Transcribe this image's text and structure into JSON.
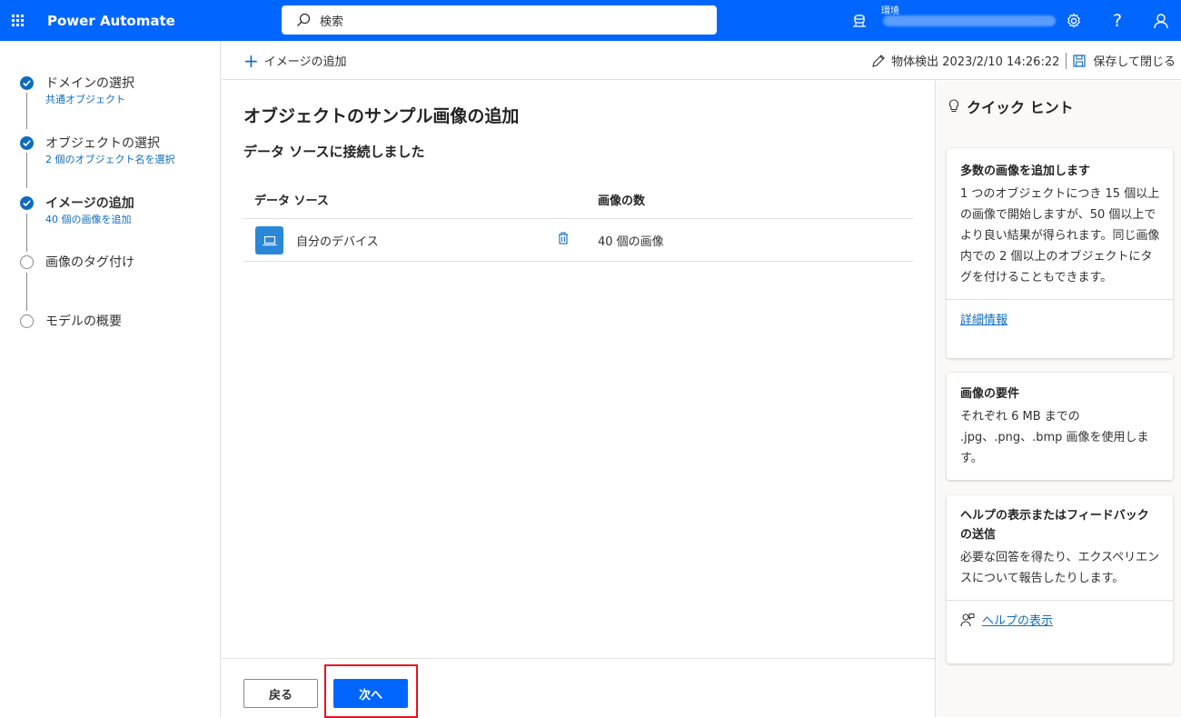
{
  "colors": {
    "topbar": "#0066ff",
    "accent": "#0f6cbd",
    "highlight": "#e81123",
    "device_icon": "#2b88d8"
  },
  "topbar": {
    "app_name": "Power Automate",
    "search_placeholder": "検索",
    "env_label": "環境"
  },
  "stepper": {
    "steps": [
      {
        "title": "ドメインの選択",
        "sub": "共通オブジェクト",
        "state": "done"
      },
      {
        "title": "オブジェクトの選択",
        "sub": "2 個のオブジェクト名を選択",
        "state": "done"
      },
      {
        "title": "イメージの追加",
        "sub": "40 個の画像を追加",
        "state": "current"
      },
      {
        "title": "画像のタグ付け",
        "sub": "",
        "state": "todo"
      },
      {
        "title": "モデルの概要",
        "sub": "",
        "state": "todo"
      }
    ]
  },
  "cmdbar": {
    "add_image": "イメージの追加",
    "model_name": "物体検出 2023/2/10 14:26:22",
    "save_close": "保存して閉じる"
  },
  "main": {
    "title": "オブジェクトのサンプル画像の追加",
    "subtitle": "データ ソースに接続しました",
    "table": {
      "headers": {
        "source": "データ ソース",
        "count": "画像の数"
      },
      "rows": [
        {
          "source": "自分のデバイス",
          "count": "40 個の画像"
        }
      ]
    }
  },
  "footer": {
    "back": "戻る",
    "next": "次へ"
  },
  "hints": {
    "title": "クイック ヒント",
    "cards": [
      {
        "title": "多数の画像を追加します",
        "text": "1 つのオブジェクトにつき 15 個以上の画像で開始しますが、50 個以上でより良い結果が得られます。同じ画像内での 2 個以上のオブジェクトにタグを付けることもできます。",
        "link": "詳細情報"
      },
      {
        "title": "画像の要件",
        "text": "それぞれ 6 MB までの .jpg、.png、.bmp 画像を使用します。"
      },
      {
        "title": "ヘルプの表示またはフィードバックの送信",
        "text": "必要な回答を得たり、エクスペリエンスについて報告したりします。",
        "link": "ヘルプの表示"
      }
    ]
  }
}
